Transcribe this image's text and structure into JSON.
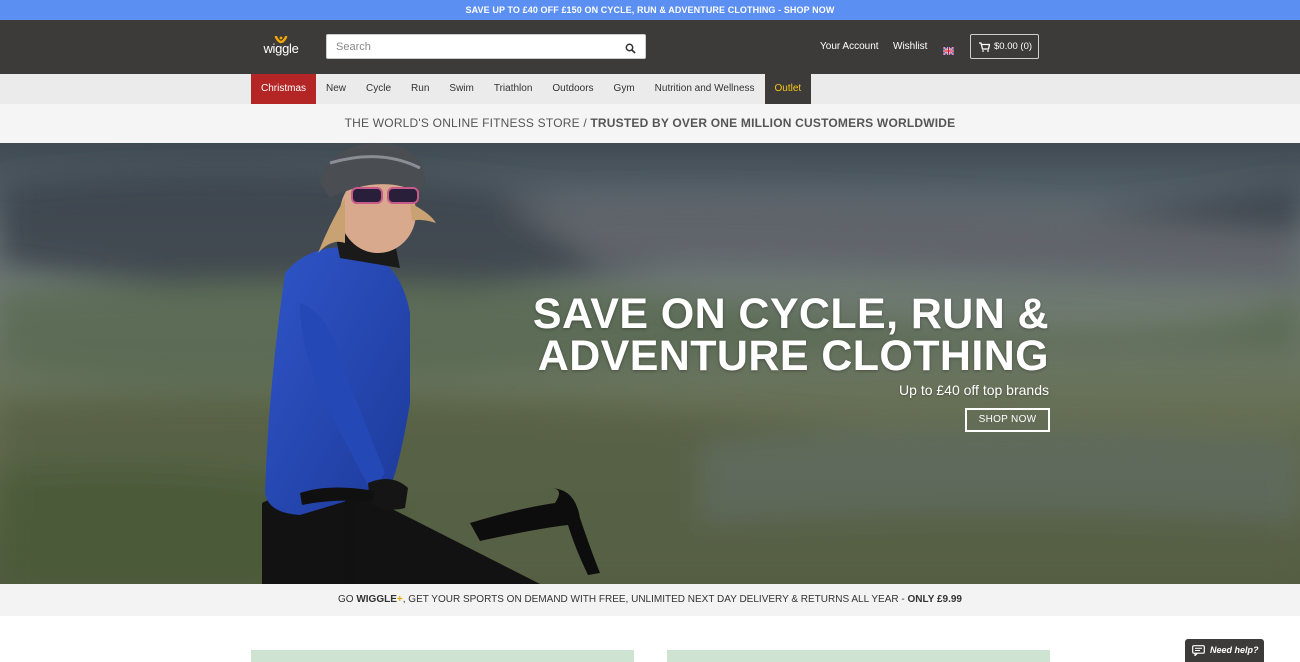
{
  "promo_banner": {
    "text": "SAVE UP TO £40 OFF £150 ON CYCLE, RUN & ADVENTURE CLOTHING - SHOP NOW"
  },
  "header": {
    "logo_text": "wiggle",
    "search": {
      "placeholder": "Search",
      "value": ""
    },
    "links": {
      "account": "Your Account",
      "wishlist": "Wishlist"
    },
    "cart_label": "$0.00 (0)"
  },
  "nav": {
    "items": [
      "Christmas",
      "New",
      "Cycle",
      "Run",
      "Swim",
      "Triathlon",
      "Outdoors",
      "Gym",
      "Nutrition and Wellness",
      "Outlet"
    ]
  },
  "tagline": {
    "prefix": "THE WORLD'S ONLINE FITNESS STORE / ",
    "emphasis": "TRUSTED BY OVER ONE MILLION CUSTOMERS WORLDWIDE"
  },
  "hero": {
    "headline_line1": "SAVE ON CYCLE, RUN &",
    "headline_line2": "ADVENTURE CLOTHING",
    "subheading": "Up to £40 off top brands",
    "cta_label": "SHOP NOW"
  },
  "plus_bar": {
    "go": "GO ",
    "brand": "WIGGLE",
    "plus": "+",
    "middle": ", GET YOUR SPORTS ON DEMAND WITH FREE, UNLIMITED NEXT DAY DELIVERY & RETURNS ALL YEAR - ",
    "price": "ONLY £9.99"
  },
  "help_widget": {
    "label": "Need help?"
  },
  "colors": {
    "promo_bg": "#5b8ff2",
    "header_bg": "#3d3b39",
    "christmas_tab": "#b42525",
    "outlet_text": "#f5c518",
    "logo_accent": "#f5a800"
  },
  "icons": [
    "search-icon",
    "flag-icon",
    "cart-icon",
    "chat-icon",
    "wiggle-logo-mark"
  ]
}
